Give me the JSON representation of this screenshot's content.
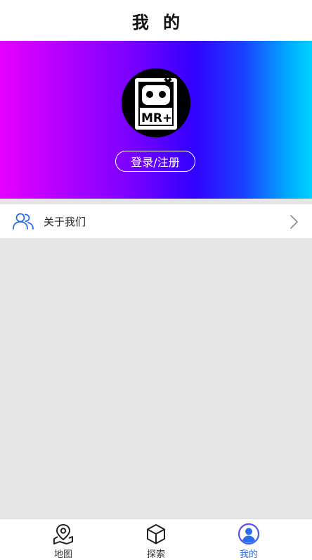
{
  "header": {
    "title": "我 的"
  },
  "profile": {
    "login_label": "登录/注册",
    "avatar_text": "MR+"
  },
  "menu": {
    "about_label": "关于我们"
  },
  "tabbar": {
    "items": [
      {
        "label": "地图",
        "icon": "map-pin-icon"
      },
      {
        "label": "探索",
        "icon": "cube-icon"
      },
      {
        "label": "我的",
        "icon": "user-circle-icon",
        "active": true
      }
    ]
  },
  "colors": {
    "accent": "#2a6cf0",
    "gradient_start": "#e600ff",
    "gradient_end": "#00d2ff"
  }
}
